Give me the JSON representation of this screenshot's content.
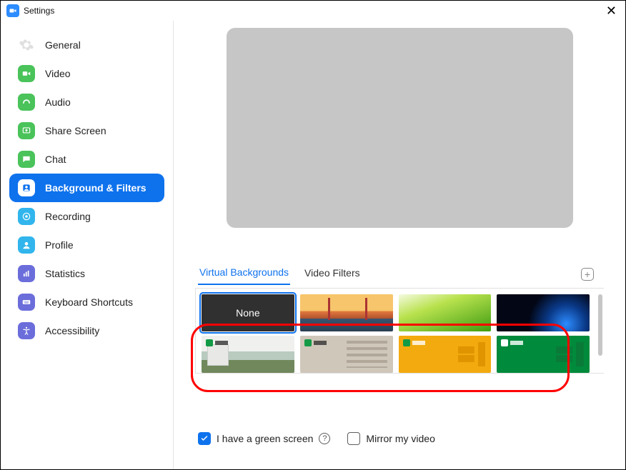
{
  "window": {
    "title": "Settings"
  },
  "sidebar": {
    "items": [
      {
        "id": "general",
        "label": "General",
        "active": false
      },
      {
        "id": "video",
        "label": "Video",
        "active": false
      },
      {
        "id": "audio",
        "label": "Audio",
        "active": false
      },
      {
        "id": "share",
        "label": "Share Screen",
        "active": false
      },
      {
        "id": "chat",
        "label": "Chat",
        "active": false
      },
      {
        "id": "bgfilt",
        "label": "Background & Filters",
        "active": true
      },
      {
        "id": "record",
        "label": "Recording",
        "active": false
      },
      {
        "id": "profile",
        "label": "Profile",
        "active": false
      },
      {
        "id": "stats",
        "label": "Statistics",
        "active": false
      },
      {
        "id": "keys",
        "label": "Keyboard Shortcuts",
        "active": false
      },
      {
        "id": "access",
        "label": "Accessibility",
        "active": false
      }
    ]
  },
  "tabs": {
    "virtual_bg": "Virtual Backgrounds",
    "filters": "Video Filters",
    "active": "virtual_bg",
    "add_label": "+"
  },
  "thumbnails": {
    "none_label": "None",
    "row2": [
      "campus",
      "beige",
      "yellow",
      "green"
    ]
  },
  "controls": {
    "green_screen": {
      "label": "I have a green screen",
      "checked": true
    },
    "mirror": {
      "label": "Mirror my video",
      "checked": false
    }
  },
  "colors": {
    "accent": "#0e72ed",
    "annotation": "#ff0000"
  }
}
